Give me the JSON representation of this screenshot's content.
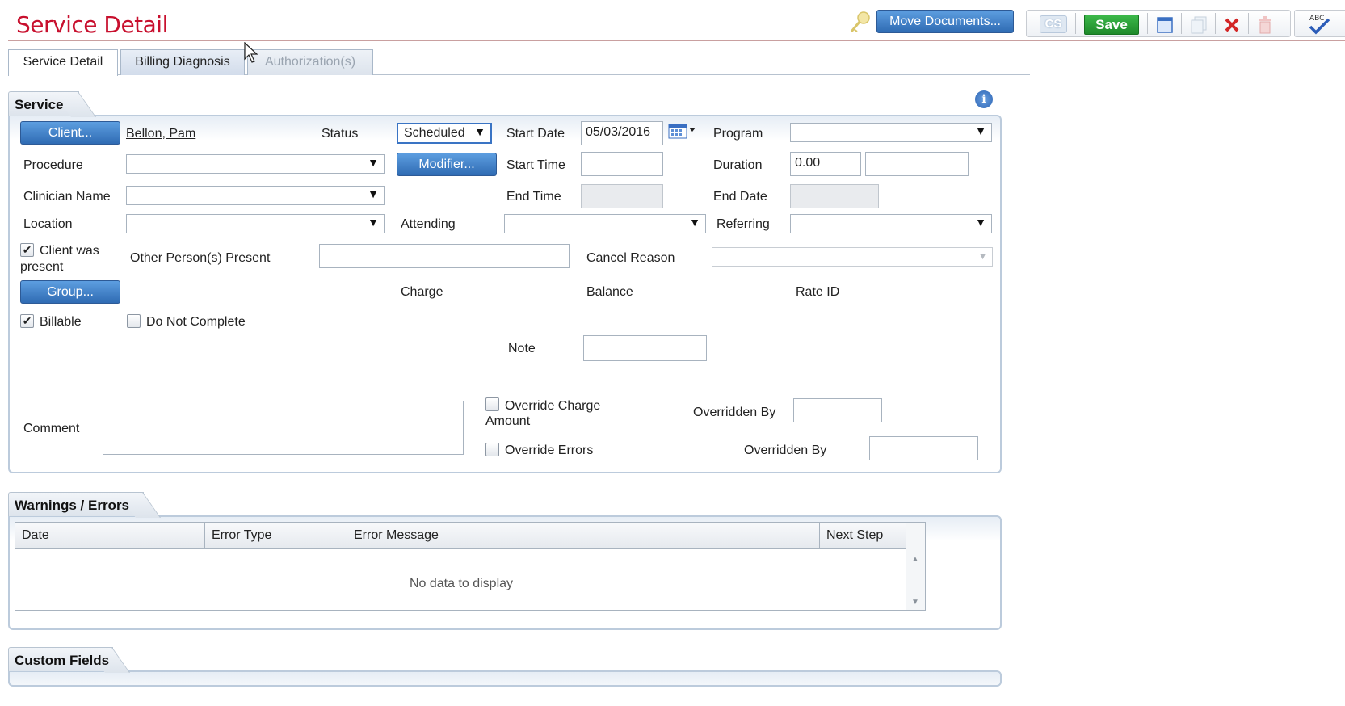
{
  "header": {
    "title": "Service Detail",
    "move_documents": "Move Documents...",
    "save": "Save"
  },
  "toolbar": {
    "icons": [
      "key-icon",
      "cs-icon",
      "new-document-icon",
      "copy-icon",
      "delete-icon",
      "trash-icon",
      "spellcheck-icon"
    ],
    "cs_label": "CS"
  },
  "tabs": [
    {
      "label": "Service Detail",
      "state": "active"
    },
    {
      "label": "Billing Diagnosis",
      "state": "inactive"
    },
    {
      "label": "Authorization(s)",
      "state": "disabled"
    }
  ],
  "service": {
    "section_title": "Service",
    "client_button": "Client...",
    "client_name": "Bellon, Pam",
    "status_label": "Status",
    "status_value": "Scheduled",
    "start_date_label": "Start Date",
    "start_date_value": "05/03/2016",
    "program_label": "Program",
    "procedure_label": "Procedure",
    "modifier_button": "Modifier...",
    "start_time_label": "Start Time",
    "duration_label": "Duration",
    "duration_value": "0.00",
    "clinician_label": "Clinician Name",
    "end_time_label": "End Time",
    "end_date_label": "End Date",
    "location_label": "Location",
    "attending_label": "Attending",
    "referring_label": "Referring",
    "client_present_label_1": "Client was",
    "client_present_label_2": "present",
    "client_present_checked": "✔",
    "other_person_label": "Other Person(s) Present",
    "cancel_reason_label": "Cancel Reason",
    "group_button": "Group...",
    "charge_label": "Charge",
    "balance_label": "Balance",
    "rate_id_label": "Rate ID",
    "billable_label": "Billable",
    "billable_checked": "✔",
    "do_not_complete_label": "Do Not Complete",
    "note_label": "Note",
    "comment_label": "Comment",
    "override_charge_label_1": "Override Charge",
    "override_charge_label_2": "Amount",
    "overridden_by_label_1": "Overridden By",
    "override_errors_label": "Override Errors",
    "overridden_by_label_2": "Overridden By"
  },
  "warnings": {
    "section_title": "Warnings / Errors",
    "columns": [
      "Date",
      "Error Type",
      "Error Message",
      "Next Step"
    ],
    "empty_text": "No data to display"
  },
  "custom_fields": {
    "section_title": "Custom Fields"
  }
}
